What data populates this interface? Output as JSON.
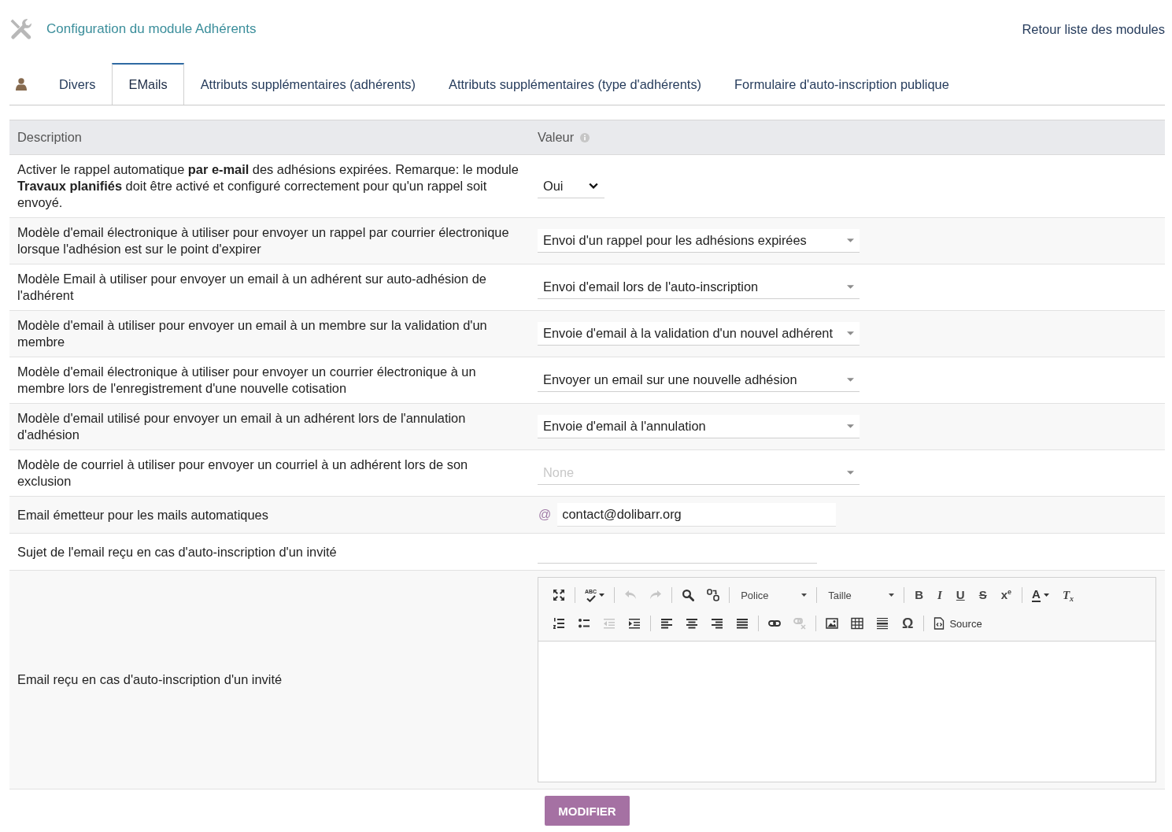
{
  "header": {
    "title": "Configuration du module Adhérents",
    "back_link": "Retour liste des modules"
  },
  "tabs": [
    {
      "label": "Divers",
      "selected": false
    },
    {
      "label": "EMails",
      "selected": true
    },
    {
      "label": "Attributs supplémentaires (adhérents)",
      "selected": false
    },
    {
      "label": "Attributs supplémentaires (type d'adhérents)",
      "selected": false
    },
    {
      "label": "Formulaire d'auto-inscription publique",
      "selected": false
    }
  ],
  "table": {
    "columns": [
      {
        "label": "Description",
        "info": false
      },
      {
        "label": "Valeur",
        "info": true
      }
    ],
    "rows": [
      {
        "description": "Activer le rappel automatique **par e-mail** des adhésions expirées. Remarque: le module **Travaux planifiés** doit être activé et configuré correctement pour qu'un rappel soit envoyé.",
        "field": {
          "kind": "compact",
          "value": "Oui"
        }
      },
      {
        "description": "Modèle d'email électronique à utiliser pour envoyer un rappel par courrier électronique lorsque l'adhésion est sur le point d'expirer",
        "field": {
          "kind": "select",
          "value": "Envoi d'un rappel pour les adhésions expirées"
        }
      },
      {
        "description": "Modèle Email à utiliser pour envoyer un email à un adhérent sur auto-adhésion de l'adhérent",
        "field": {
          "kind": "select",
          "value": "Envoi d'email lors de l'auto-inscription"
        }
      },
      {
        "description": "Modèle d'email à utiliser pour envoyer un email à un membre sur la validation d'un membre",
        "field": {
          "kind": "select",
          "value": "Envoie d'email à la validation d'un nouvel adhérent"
        }
      },
      {
        "description": "Modèle d'email électronique à utiliser pour envoyer un courrier électronique à un membre lors de l'enregistrement d'une nouvelle cotisation",
        "field": {
          "kind": "select",
          "value": "Envoyer un email sur une nouvelle adhésion"
        }
      },
      {
        "description": "Modèle d'email utilisé pour envoyer un email à un adhérent lors de l'annulation d'adhésion",
        "field": {
          "kind": "select",
          "value": "Envoie d'email à l'annulation"
        }
      },
      {
        "description": "Modèle de courriel à utiliser pour envoyer un courriel à un adhérent lors de son exclusion",
        "field": {
          "kind": "select",
          "placeholder": "None"
        }
      },
      {
        "description": "Email émetteur pour les mails automatiques",
        "field": {
          "kind": "email",
          "symbol": "@",
          "value": "contact@dolibarr.org"
        }
      },
      {
        "description": "Sujet de l'email reçu en cas d'auto-inscription d'un invité",
        "field": {
          "kind": "text"
        }
      },
      {
        "description": "Email reçu en cas d'auto-inscription d'un invité",
        "field": {
          "kind": "editor",
          "toolbar": [
            [
              [
                {
                  "kind": "maximize",
                  "disabled": false
                }
              ],
              [
                {
                  "kind": "spellcheck",
                  "label": "ABC",
                  "disabled": false
                }
              ],
              [
                {
                  "kind": "undo",
                  "disabled": true
                },
                {
                  "kind": "redo",
                  "disabled": true
                }
              ],
              [
                {
                  "kind": "find",
                  "disabled": false
                },
                {
                  "kind": "replace",
                  "disabled": false
                }
              ],
              [
                {
                  "kind": "combo",
                  "label": "Police",
                  "disabled": false
                }
              ],
              [
                {
                  "kind": "combo",
                  "label": "Taille",
                  "disabled": false
                }
              ],
              [
                {
                  "kind": "bold",
                  "label": "B",
                  "disabled": false
                },
                {
                  "kind": "italic",
                  "label": "I",
                  "disabled": false
                },
                {
                  "kind": "underline",
                  "label": "U",
                  "disabled": false
                },
                {
                  "kind": "strike",
                  "label": "S",
                  "disabled": false
                },
                {
                  "kind": "superscript",
                  "label": "x$^{e}$",
                  "disabled": false
                }
              ],
              [
                {
                  "kind": "textcolor",
                  "label": "A",
                  "disabled": false
                },
                {
                  "kind": "removeformat",
                  "label": "T$_{x}$",
                  "disabled": false
                }
              ]
            ],
            [
              [
                {
                  "kind": "numbered",
                  "disabled": false
                },
                {
                  "kind": "bulleted",
                  "disabled": false
                },
                {
                  "kind": "outdent",
                  "disabled": true
                },
                {
                  "kind": "indent",
                  "disabled": false
                }
              ],
              [
                {
                  "kind": "alignleft",
                  "disabled": false
                },
                {
                  "kind": "aligncenter",
                  "disabled": false
                },
                {
                  "kind": "alignright",
                  "disabled": false
                },
                {
                  "kind": "justify",
                  "disabled": false
                }
              ],
              [
                {
                  "kind": "link",
                  "disabled": false
                },
                {
                  "kind": "unlink",
                  "disabled": true
                }
              ],
              [
                {
                  "kind": "image",
                  "disabled": false
                },
                {
                  "kind": "table",
                  "disabled": false
                },
                {
                  "kind": "hr",
                  "disabled": false
                },
                {
                  "kind": "specialchar",
                  "label": "Ω",
                  "disabled": false
                }
              ],
              [
                {
                  "kind": "source",
                  "label": "Source",
                  "disabled": false
                }
              ]
            ]
          ]
        }
      }
    ]
  },
  "submit": "MODIFIER"
}
